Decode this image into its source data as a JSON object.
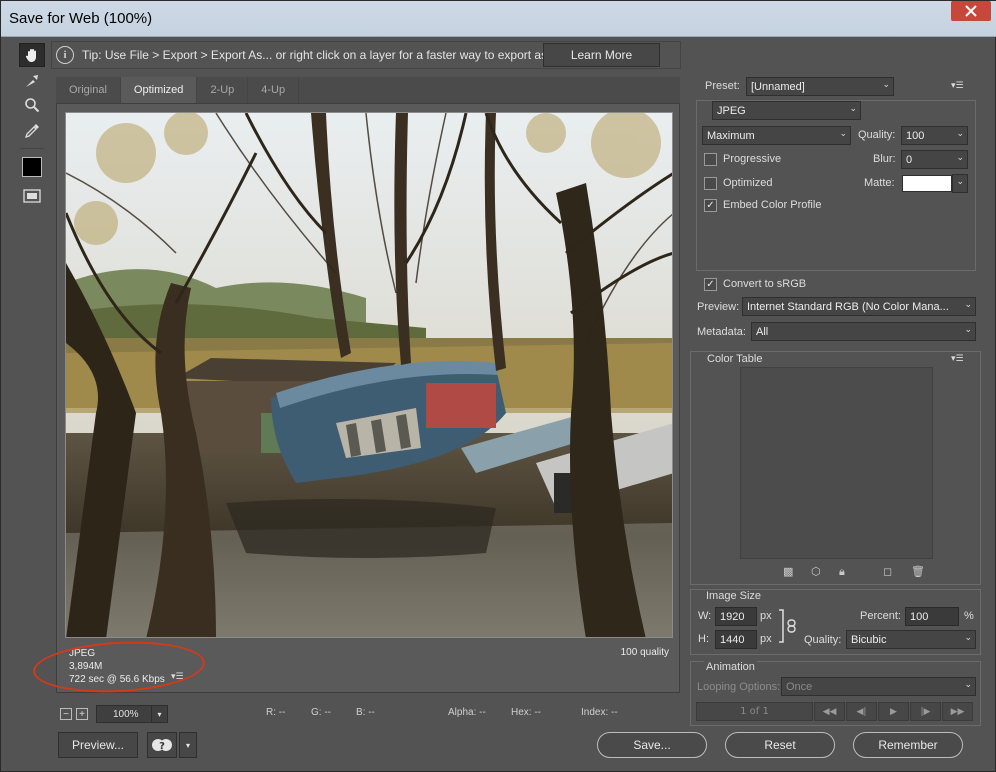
{
  "window": {
    "title": "Save for Web (100%)"
  },
  "tip": {
    "text": "Tip: Use File > Export > Export As...  or right click on a layer for a faster way to export assets",
    "button": "Learn More"
  },
  "tabs": [
    "Original",
    "Optimized",
    "2-Up",
    "4-Up"
  ],
  "image_info": {
    "format": "JPEG",
    "size": "3,894M",
    "time": "722 sec @ 56.6 Kbps",
    "quality": "100 quality"
  },
  "statusbar": {
    "zoom": "100%",
    "r": "R: --",
    "g": "G: --",
    "b": "B: --",
    "alpha": "Alpha: --",
    "hex": "Hex: --",
    "index": "Index: --"
  },
  "settings": {
    "preset_label": "Preset:",
    "preset_value": "[Unnamed]",
    "format": "JPEG",
    "compression": "Maximum",
    "quality_label": "Quality:",
    "quality_value": "100",
    "progressive_label": "Progressive",
    "progressive_checked": false,
    "blur_label": "Blur:",
    "blur_value": "0",
    "optimized_label": "Optimized",
    "optimized_checked": false,
    "matte_label": "Matte:",
    "matte_color": "#ffffff",
    "embed_label": "Embed Color Profile",
    "embed_checked": true,
    "convert_label": "Convert to sRGB",
    "convert_checked": true,
    "preview_label": "Preview:",
    "preview_value": "Internet Standard RGB (No Color Mana...",
    "metadata_label": "Metadata:",
    "metadata_value": "All"
  },
  "color_table": {
    "title": "Color Table"
  },
  "image_size": {
    "title": "Image Size",
    "w_label": "W:",
    "w_value": "1920",
    "h_label": "H:",
    "h_value": "1440",
    "unit": "px",
    "percent_label": "Percent:",
    "percent_value": "100",
    "percent_unit": "%",
    "quality_label": "Quality:",
    "quality_value": "Bicubic"
  },
  "animation": {
    "title": "Animation",
    "looping_label": "Looping Options:",
    "looping_value": "Once",
    "page": "1 of 1"
  },
  "buttons": {
    "preview": "Preview...",
    "save": "Save...",
    "reset": "Reset",
    "remember": "Remember"
  },
  "colors": {
    "annotation": "#d23a1c",
    "panel_bg": "#535353"
  }
}
